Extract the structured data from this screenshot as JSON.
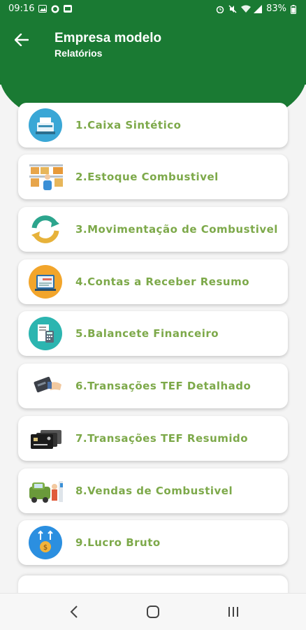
{
  "status_bar": {
    "time": "09:16",
    "battery": "83%",
    "icons_left": [
      "image-icon",
      "whatsapp-icon",
      "gallery-icon"
    ],
    "icons_right": [
      "alarm-icon",
      "mute-icon",
      "wifi-icon",
      "signal-icon",
      "battery-icon"
    ]
  },
  "header": {
    "title": "Empresa modelo",
    "subtitle": "Relatórios",
    "color": "#1a7a33"
  },
  "items": [
    {
      "label": "1.Caixa Sintético",
      "icon": "cash-register-icon"
    },
    {
      "label": "2.Estoque Combustivel",
      "icon": "warehouse-icon"
    },
    {
      "label": "3.Movimentação de Combustivel",
      "icon": "refresh-arrows-icon"
    },
    {
      "label": "4.Contas a Receber Resumo",
      "icon": "invoice-icon"
    },
    {
      "label": "5.Balancete Financeiro",
      "icon": "calculator-document-icon"
    },
    {
      "label": "6.Transações TEF Detalhado",
      "icon": "card-terminal-icon"
    },
    {
      "label": "7.Transações TEF Resumido",
      "icon": "credit-cards-icon"
    },
    {
      "label": "8.Vendas de Combustivel",
      "icon": "fuel-station-icon"
    },
    {
      "label": "9.Lucro Bruto",
      "icon": "money-up-icon"
    }
  ],
  "accent_label_color": "#7da94a",
  "navbar": {
    "icons": [
      "back-nav-icon",
      "home-nav-icon",
      "recents-nav-icon"
    ]
  }
}
